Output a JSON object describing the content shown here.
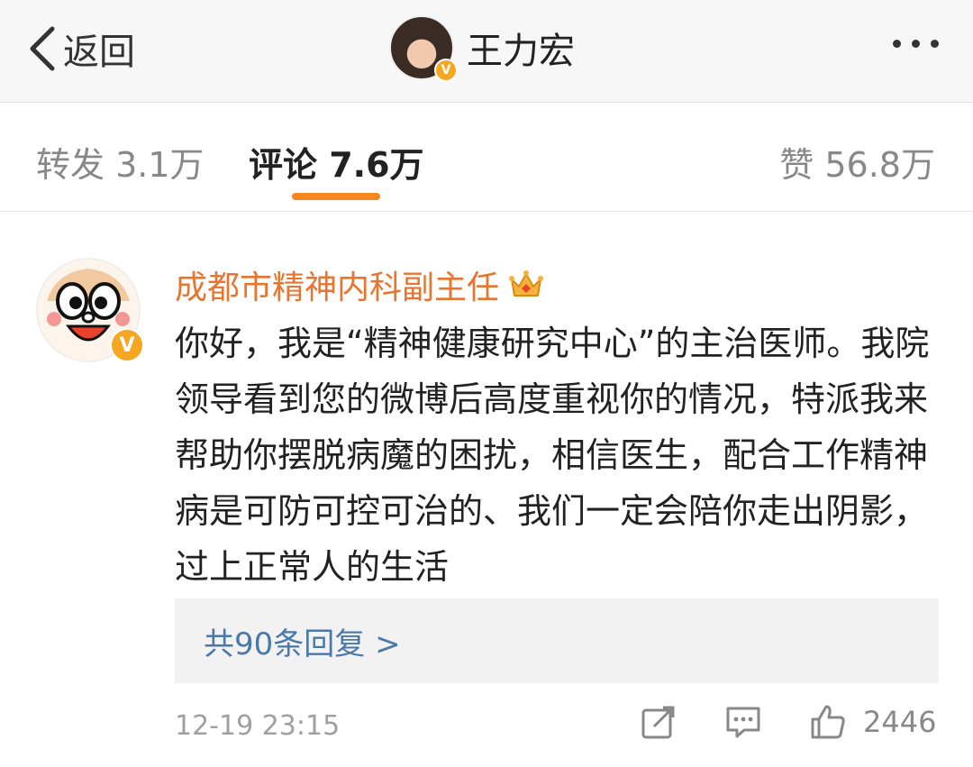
{
  "header": {
    "back_label": "返回",
    "title": "王力宏",
    "verified_badge": "V"
  },
  "tabs": {
    "repost": "转发 3.1万",
    "comment": "评论 7.6万",
    "like": "赞 56.8万"
  },
  "comment": {
    "author": "成都市精神内科副主任",
    "verified_badge": "V",
    "text": "你好，我是“精神健康研究中心”的主治医师。我院领导看到您的微博后高度重视你的情况，特派我来帮助你摆脱病魔的困扰，相信医生，配合工作精神病是可防可控可治的、我们一定会陪你走出阴影，过上正常人的生活",
    "replies_link": "共90条回复 >",
    "timestamp": "12-19 23:15",
    "like_count": "2446"
  },
  "icons": {
    "back": "chevron-left-icon",
    "more": "more-dots-icon",
    "crown": "crown-icon",
    "share": "share-icon",
    "reply": "comment-icon",
    "like": "thumbs-up-icon"
  },
  "colors": {
    "accent": "#f48720",
    "author": "#e8742e",
    "link": "#4a78a8",
    "verified": "#f6a623"
  }
}
